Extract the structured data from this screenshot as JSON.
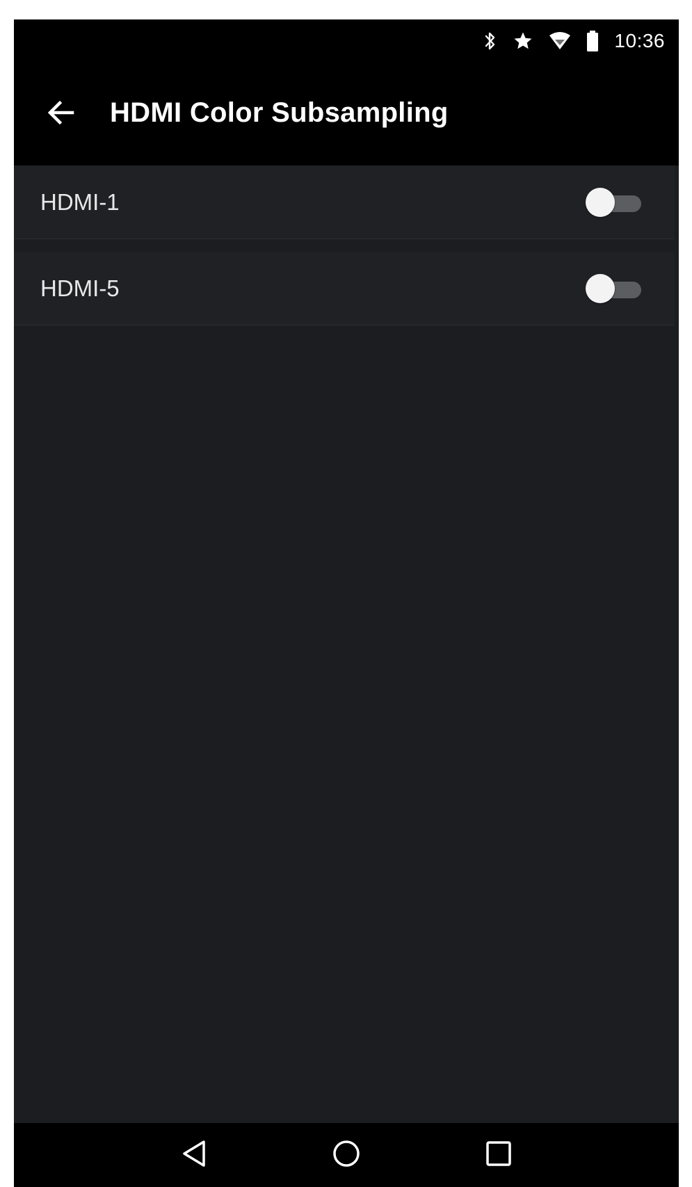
{
  "status_bar": {
    "time": "10:36",
    "icons": [
      "bluetooth-icon",
      "star-icon",
      "wifi-icon",
      "battery-icon"
    ]
  },
  "app_bar": {
    "back_icon": "arrow-left-icon",
    "title": "HDMI Color Subsampling"
  },
  "settings": {
    "items": [
      {
        "label": "HDMI-1",
        "enabled": false
      },
      {
        "label": "HDMI-5",
        "enabled": false
      }
    ]
  },
  "nav_bar": {
    "buttons": [
      "back-triangle-icon",
      "home-circle-icon",
      "recents-square-icon"
    ]
  },
  "colors": {
    "background": "#1b1d20",
    "bars": "#000000",
    "text": "#ffffff",
    "toggle_track_off": "#5b5d60",
    "toggle_thumb": "#f3f3f3"
  }
}
